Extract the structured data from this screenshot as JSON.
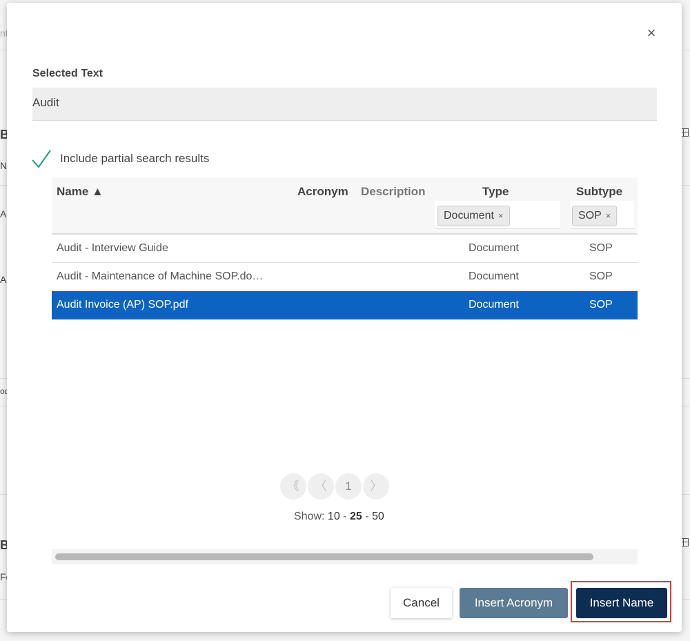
{
  "background": {
    "fragments": [
      "nt",
      "B",
      "Nc",
      "Al",
      "Au",
      "od",
      "B",
      "Fc"
    ]
  },
  "dialog": {
    "close_symbol": "×",
    "selected_text_label": "Selected Text",
    "selected_text_value": "Audit",
    "partial_search": {
      "label": "Include partial search results",
      "checked": true
    },
    "table": {
      "columns": {
        "name": "Name ▲",
        "acronym": "Acronym",
        "description": "Description",
        "type": "Type",
        "subtype": "Subtype"
      },
      "filters": {
        "type_chip": "Document",
        "subtype_chip": "SOP",
        "remove_symbol": "×"
      },
      "rows": [
        {
          "name": "Audit - Interview Guide",
          "acronym": "",
          "description": "",
          "type": "Document",
          "subtype": "SOP",
          "selected": false
        },
        {
          "name": "Audit - Maintenance of Machine SOP.do…",
          "acronym": "",
          "description": "",
          "type": "Document",
          "subtype": "SOP",
          "selected": false
        },
        {
          "name": "Audit Invoice (AP) SOP.pdf",
          "acronym": "",
          "description": "",
          "type": "Document",
          "subtype": "SOP",
          "selected": true
        }
      ]
    },
    "pagination": {
      "first": "《",
      "prev": "〈",
      "current_page": "1",
      "next": "〉",
      "show_label": "Show:",
      "size_10": "10",
      "size_25": "25",
      "size_50": "50",
      "separator": "-"
    },
    "buttons": {
      "cancel": "Cancel",
      "insert_acronym": "Insert Acronym",
      "insert_name": "Insert Name"
    }
  },
  "colors": {
    "selected_row": "#0d63c1",
    "primary_button": "#0d2d52",
    "secondary_button": "#5b7a93",
    "check": "#1a9a8a",
    "highlight": "#e53935"
  }
}
